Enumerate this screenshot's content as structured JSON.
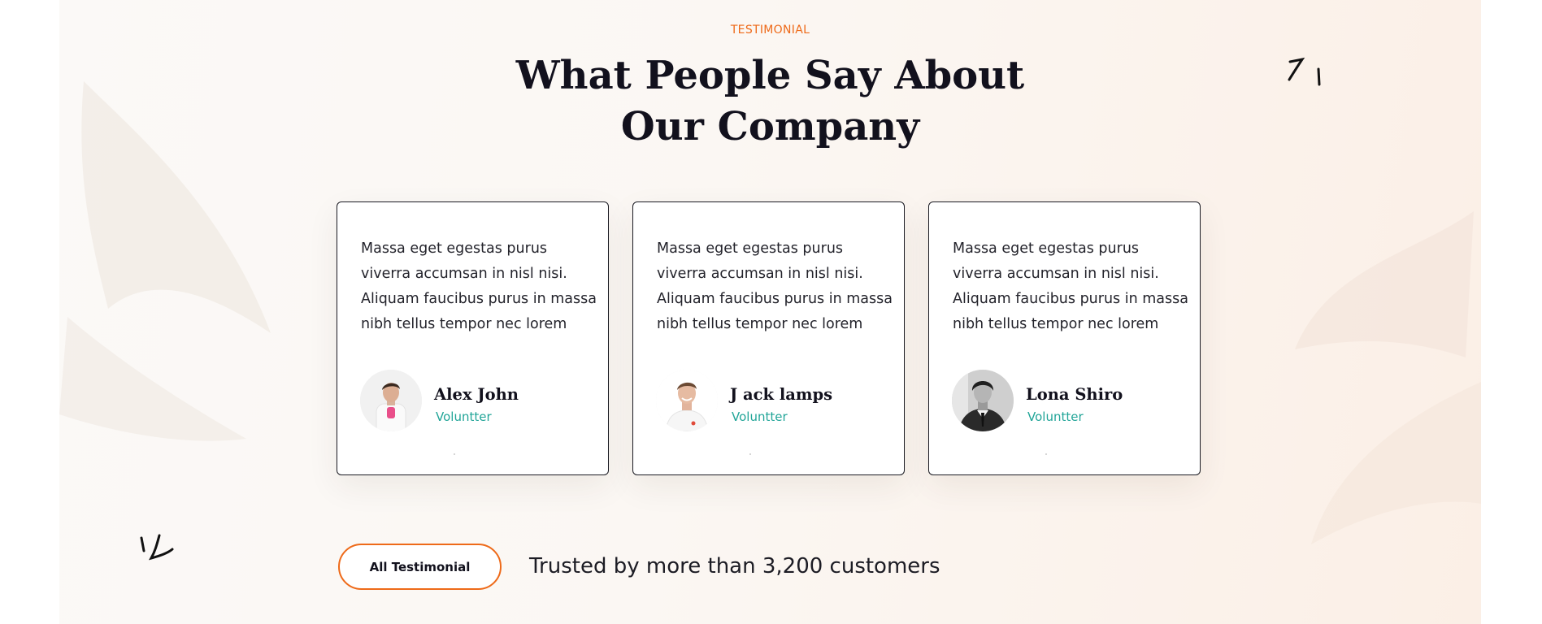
{
  "section": {
    "eyebrow": "TESTIMONIAL",
    "heading_line1": "What People Say About",
    "heading_line2": "Our Company"
  },
  "testimonials": [
    {
      "text": "Massa eget egestas purus viverra accumsan in nisl nisi. Aliquam faucibus purus in massa nibh tellus tempor nec lorem",
      "name": "Alex John",
      "role": "Voluntter",
      "avatar": "avatar-man-white-tshirt"
    },
    {
      "text": "Massa eget egestas purus viverra accumsan in nisl nisi. Aliquam faucibus purus in massa nibh tellus tempor nec lorem",
      "name": "J ack lamps",
      "role": "Voluntter",
      "avatar": "avatar-smiling-man"
    },
    {
      "text": "Massa eget egestas purus viverra accumsan in nisl nisi. Aliquam faucibus purus in massa nibh tellus tempor nec lorem",
      "name": "Lona Shiro",
      "role": "Voluntter",
      "avatar": "avatar-man-suit-bw"
    }
  ],
  "cta": {
    "button_label": "All Testimonial",
    "trusted_text": "Trusted by more than 3,200 customers"
  },
  "colors": {
    "accent": "#ee6a19",
    "role": "#22a598",
    "heading": "#12111d"
  }
}
